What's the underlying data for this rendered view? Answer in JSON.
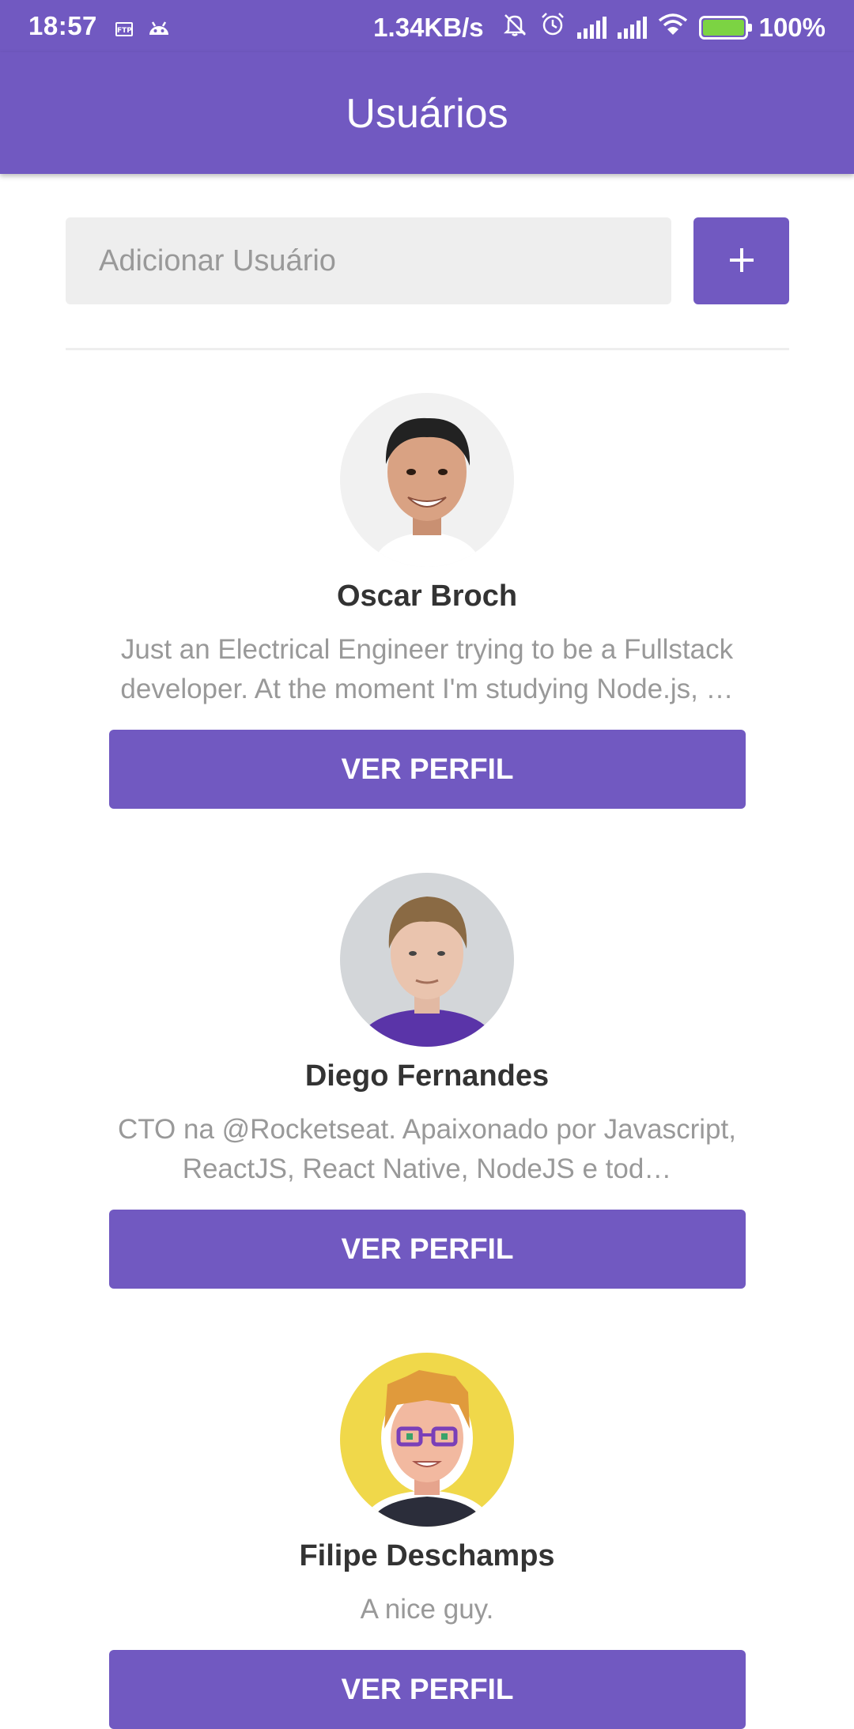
{
  "status_bar": {
    "time": "18:57",
    "network_speed": "1.34KB/s",
    "battery": "100%",
    "icons": [
      "ftp-icon",
      "android-icon",
      "mute-icon",
      "alarm-icon",
      "signal-icon",
      "signal-icon",
      "wifi-icon",
      "battery-charging-icon"
    ]
  },
  "header": {
    "title": "Usuários"
  },
  "form": {
    "placeholder": "Adicionar Usuário",
    "value": "",
    "add_icon": "plus-icon"
  },
  "users": [
    {
      "name": "Oscar Broch",
      "bio": "Just an Electrical Engineer trying to be a Fullstack developer. At the moment I'm studying Node.js, …",
      "button": "VER PERFIL"
    },
    {
      "name": "Diego Fernandes",
      "bio": "CTO na @Rocketseat. Apaixonado por Javascript, ReactJS, React Native, NodeJS e tod…",
      "button": "VER PERFIL"
    },
    {
      "name": "Filipe Deschamps",
      "bio": "A nice guy.",
      "button": "VER PERFIL"
    }
  ],
  "colors": {
    "primary": "#7159c1",
    "input_bg": "#eeeeee",
    "name_text": "#333333",
    "bio_text": "#999999",
    "battery_fill": "#7cd343"
  }
}
